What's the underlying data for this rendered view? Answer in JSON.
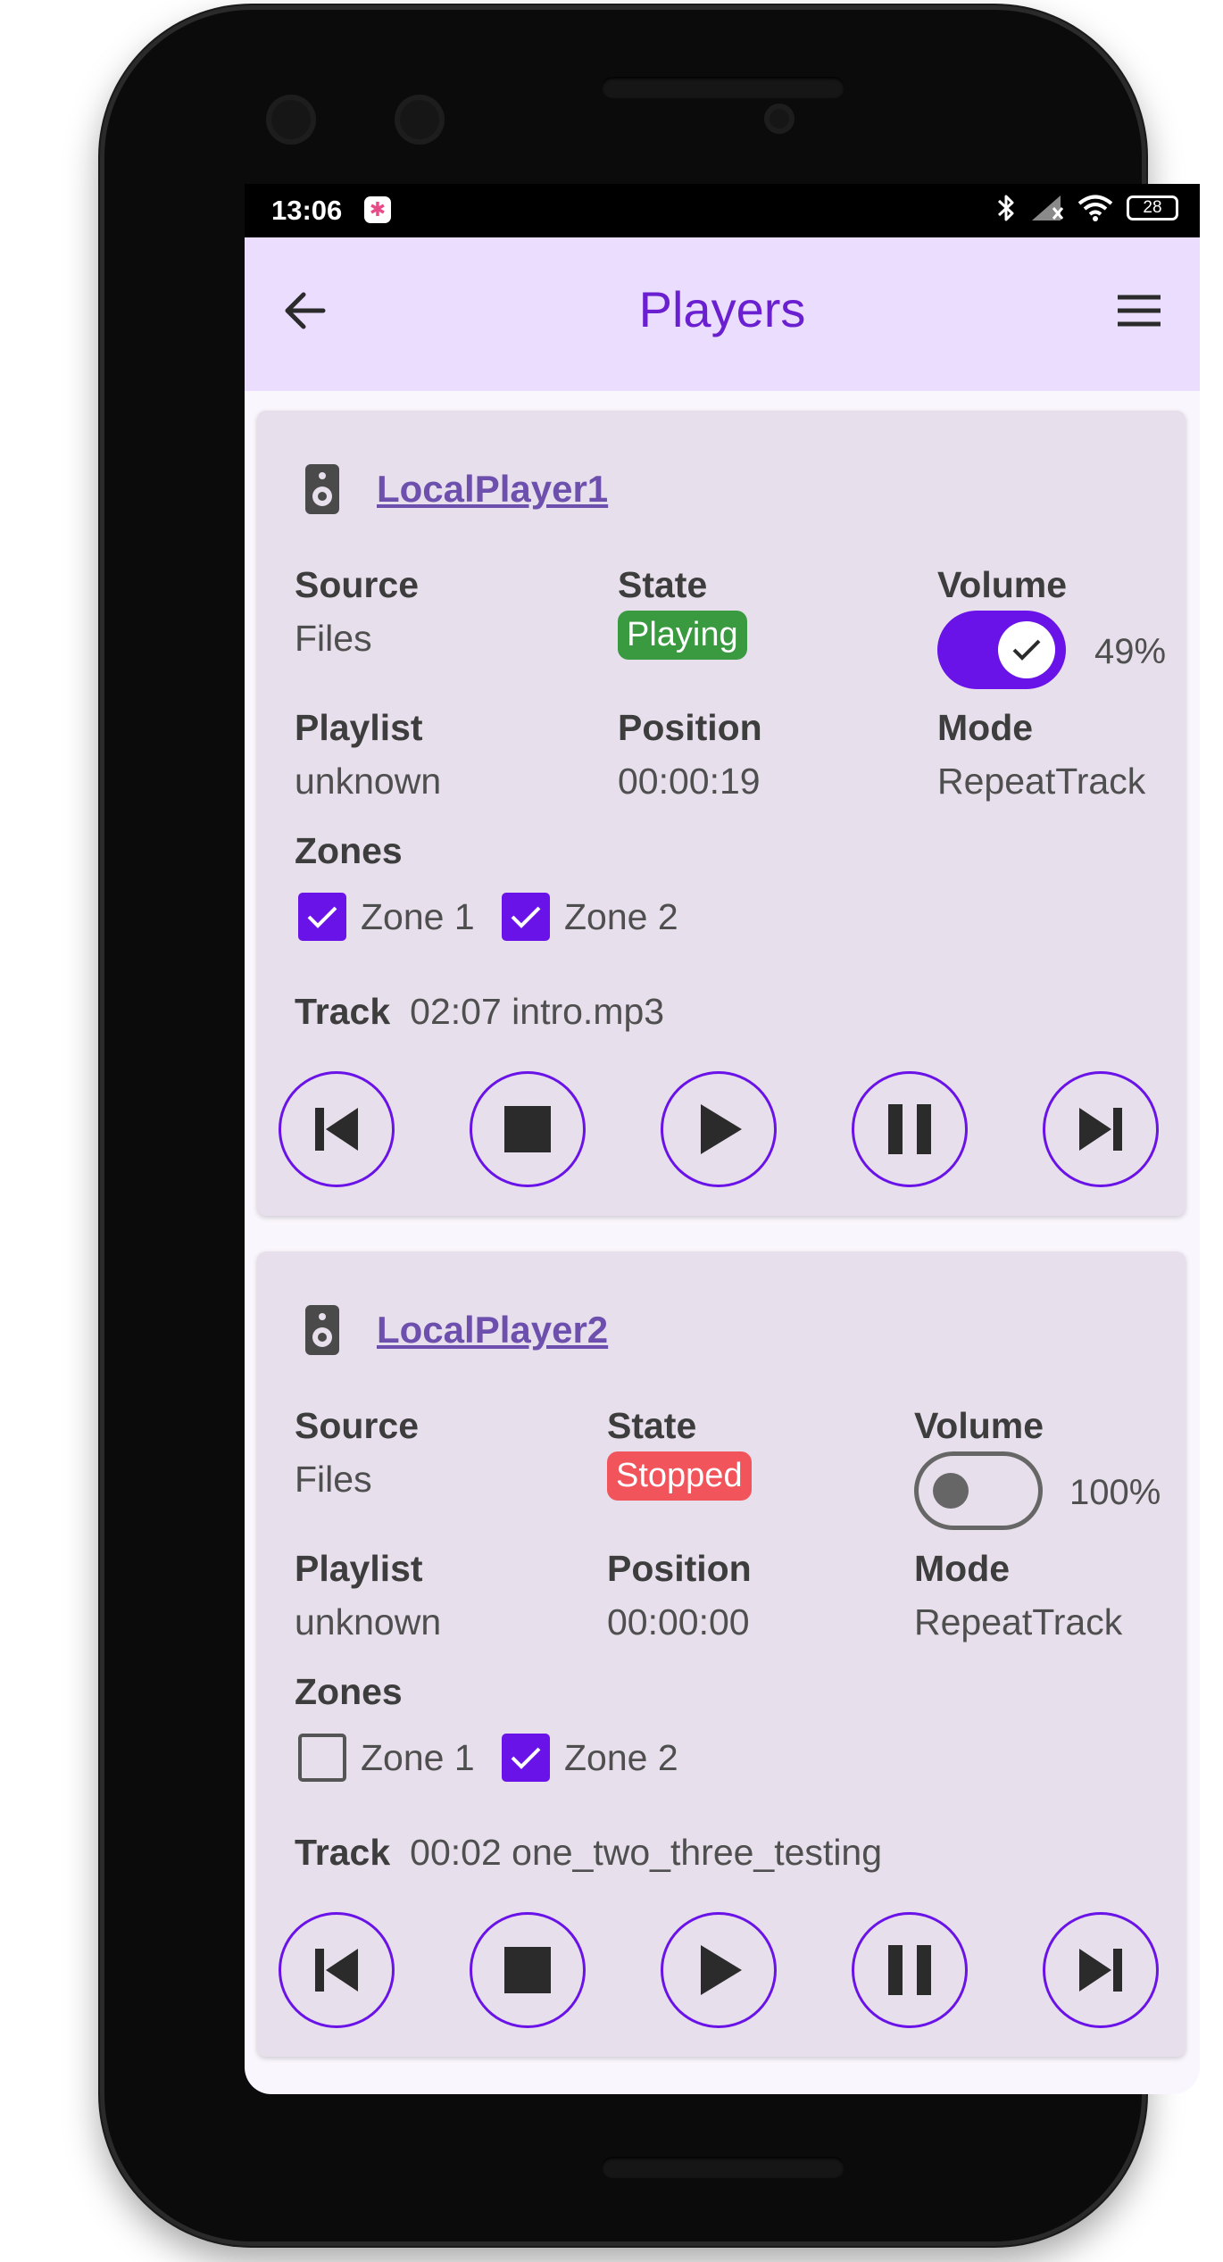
{
  "status_bar": {
    "time": "13:06",
    "battery": "28",
    "icons": [
      "bluetooth-icon",
      "signal-icon",
      "wifi-icon",
      "battery-icon"
    ]
  },
  "app_bar": {
    "title": "Players",
    "back_icon": "arrow-left-icon",
    "menu_icon": "hamburger-menu-icon"
  },
  "labels": {
    "source": "Source",
    "state": "State",
    "volume": "Volume",
    "playlist": "Playlist",
    "position": "Position",
    "mode": "Mode",
    "zones": "Zones",
    "track": "Track"
  },
  "players": [
    {
      "name": "LocalPlayer1",
      "source": "Files",
      "state": "Playing",
      "state_color": "#3a9a3f",
      "volume_enabled": true,
      "volume_pct": "49%",
      "playlist": "unknown",
      "position": "00:00:19",
      "mode": "RepeatTrack",
      "zones": [
        {
          "label": "Zone 1",
          "checked": true
        },
        {
          "label": "Zone 2",
          "checked": true
        }
      ],
      "track_time": "02:07",
      "track_name": "intro.mp3"
    },
    {
      "name": "LocalPlayer2",
      "source": "Files",
      "state": "Stopped",
      "state_color": "#f2545b",
      "volume_enabled": false,
      "volume_pct": "100%",
      "playlist": "unknown",
      "position": "00:00:00",
      "mode": "RepeatTrack",
      "zones": [
        {
          "label": "Zone 1",
          "checked": false
        },
        {
          "label": "Zone 2",
          "checked": true
        }
      ],
      "track_time": "00:02",
      "track_name": "one_two_three_testing"
    }
  ],
  "controls": [
    "skip-previous-icon",
    "stop-icon",
    "play-icon",
    "pause-icon",
    "skip-next-icon"
  ],
  "colors": {
    "accent": "#6a13e8",
    "title": "#6a1fd0",
    "app_bar_bg": "#eaddfd",
    "card_bg": "#e7dfeb"
  }
}
